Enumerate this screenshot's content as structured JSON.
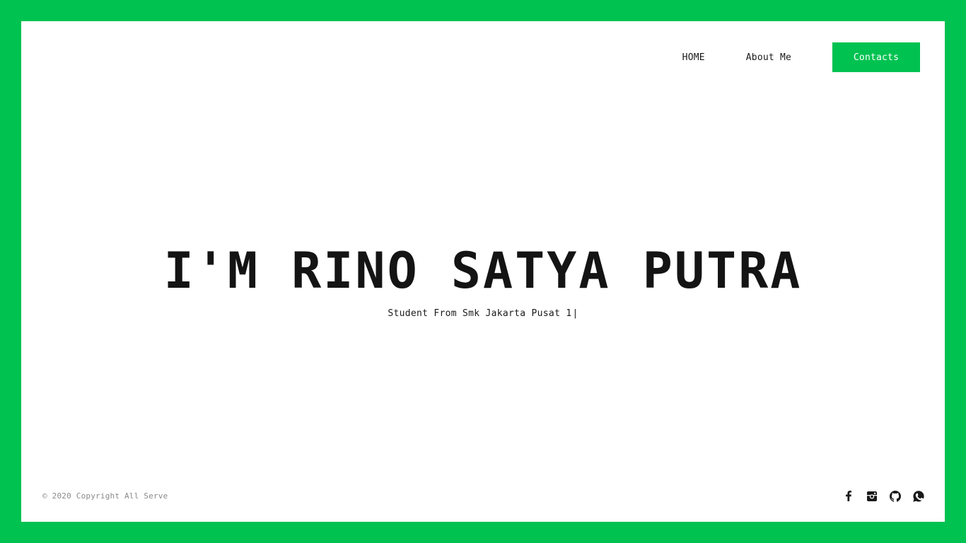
{
  "nav": {
    "home_label": "HOME",
    "about_label": "About Me",
    "contacts_label": "Contacts"
  },
  "hero": {
    "title": "I'M RINO SATYA PUTRA",
    "subtitle": "Student From Smk Jakarta Pusat 1",
    "cursor": "|"
  },
  "footer": {
    "copyright": "© 2020 Copyright All Serve"
  },
  "social_icons": [
    "facebook-icon",
    "instagram-icon",
    "github-icon",
    "whatsapp-icon"
  ],
  "colors": {
    "accent": "#00c251",
    "text": "#141414",
    "muted": "#8a8a8a",
    "background": "#ffffff"
  }
}
